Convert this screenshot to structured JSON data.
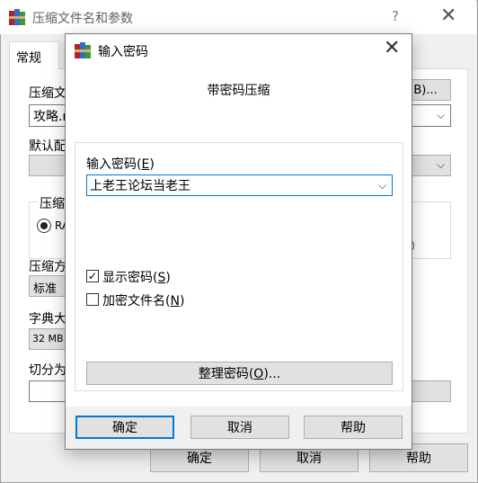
{
  "background_window": {
    "title": "压缩文件名和参数",
    "help_glyph": "?",
    "close_glyph": "✕",
    "tab_general": "常规",
    "archive_name_label": "压缩文",
    "archive_name_value": "攻略.r",
    "browse_button": "(B)...",
    "default_profile_label": "默认配",
    "archive_format_label": "压缩",
    "rar_radio_label": "RA",
    "compression_method_label": "压缩方",
    "compression_method_value": "标准",
    "dictionary_label": "字典大",
    "dictionary_value": "32 MB",
    "split_label": "切分为",
    "ok_button": "确定",
    "cancel_button": "取消",
    "help_button": "帮助"
  },
  "dialog": {
    "title": "输入密码",
    "close_glyph": "✕",
    "heading": "带密码压缩",
    "password_label": "输入密码",
    "password_mnemonic": "E",
    "password_value": "上老王论坛当老王",
    "show_password_label": "显示密码",
    "show_password_mnemonic": "S",
    "show_password_checked": true,
    "encrypt_names_label": "加密文件名",
    "encrypt_names_mnemonic": "N",
    "encrypt_names_checked": false,
    "organize_label": "整理密码",
    "organize_mnemonic": "O",
    "organize_suffix": "...",
    "ok_button": "确定",
    "cancel_button": "取消",
    "help_button": "帮助"
  },
  "icons": {
    "dropdown": "chevron-down-icon",
    "check": "✓",
    "chevron": "⌵"
  }
}
